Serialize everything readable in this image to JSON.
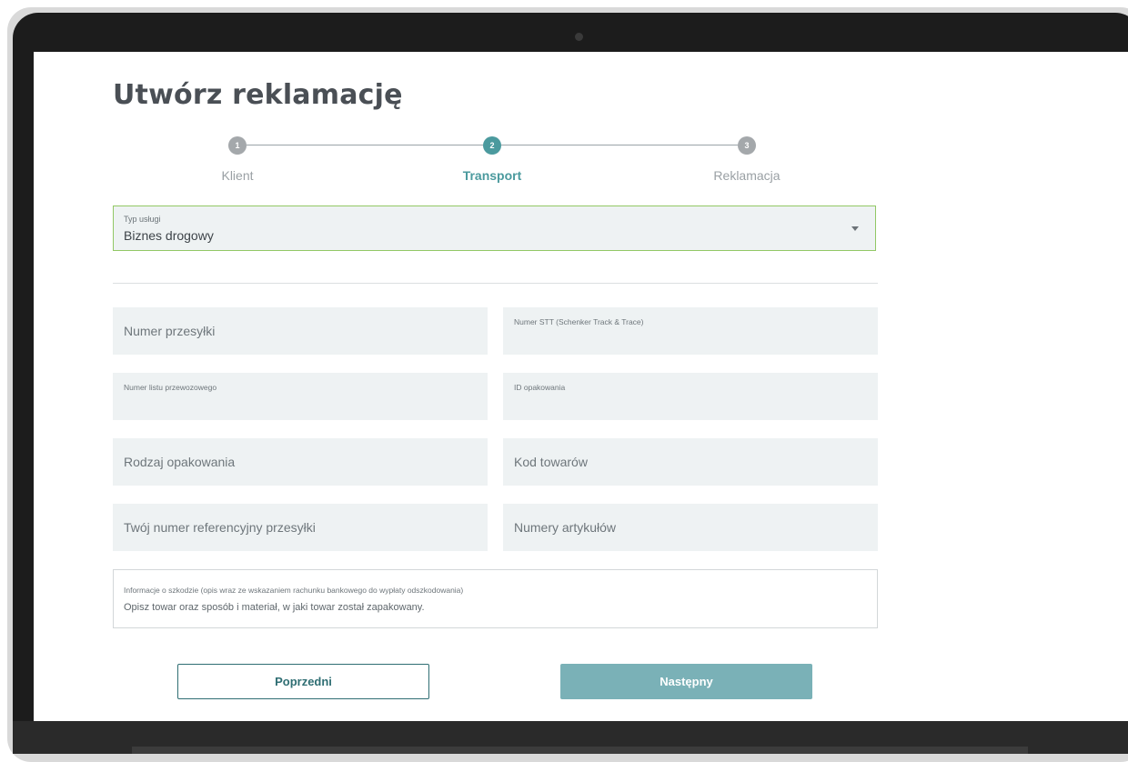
{
  "page": {
    "title": "Utwórz reklamację"
  },
  "stepper": {
    "steps": [
      {
        "number": "1",
        "label": "Klient"
      },
      {
        "number": "2",
        "label": "Transport",
        "active": true
      },
      {
        "number": "3",
        "label": "Reklamacja"
      }
    ]
  },
  "service_select": {
    "label": "Typ usługi",
    "value": "Biznes drogowy"
  },
  "fields": {
    "shipment_number": "Numer przesyłki",
    "stt_number": "Numer STT (Schenker Track & Trace)",
    "waybill_number": "Numer listu przewozowego",
    "package_id": "ID opakowania",
    "package_type": "Rodzaj opakowania",
    "goods_code": "Kod towarów",
    "reference_number": "Twój numer referencyjny przesyłki",
    "article_numbers": "Numery artykułów"
  },
  "damage_info": {
    "label": "Informacje o szkodzie (opis wraz ze wskazaniem rachunku bankowego do wypłaty odszkodowania)",
    "placeholder": "Opisz towar oraz sposób i materiał, w jaki towar został zapakowany."
  },
  "buttons": {
    "previous": "Poprzedni",
    "next": "Następny"
  },
  "colors": {
    "accent": "#4b9a9e",
    "select_border": "#92c865",
    "next_button": "#7ab1b7",
    "field_bg": "#eef2f3"
  }
}
